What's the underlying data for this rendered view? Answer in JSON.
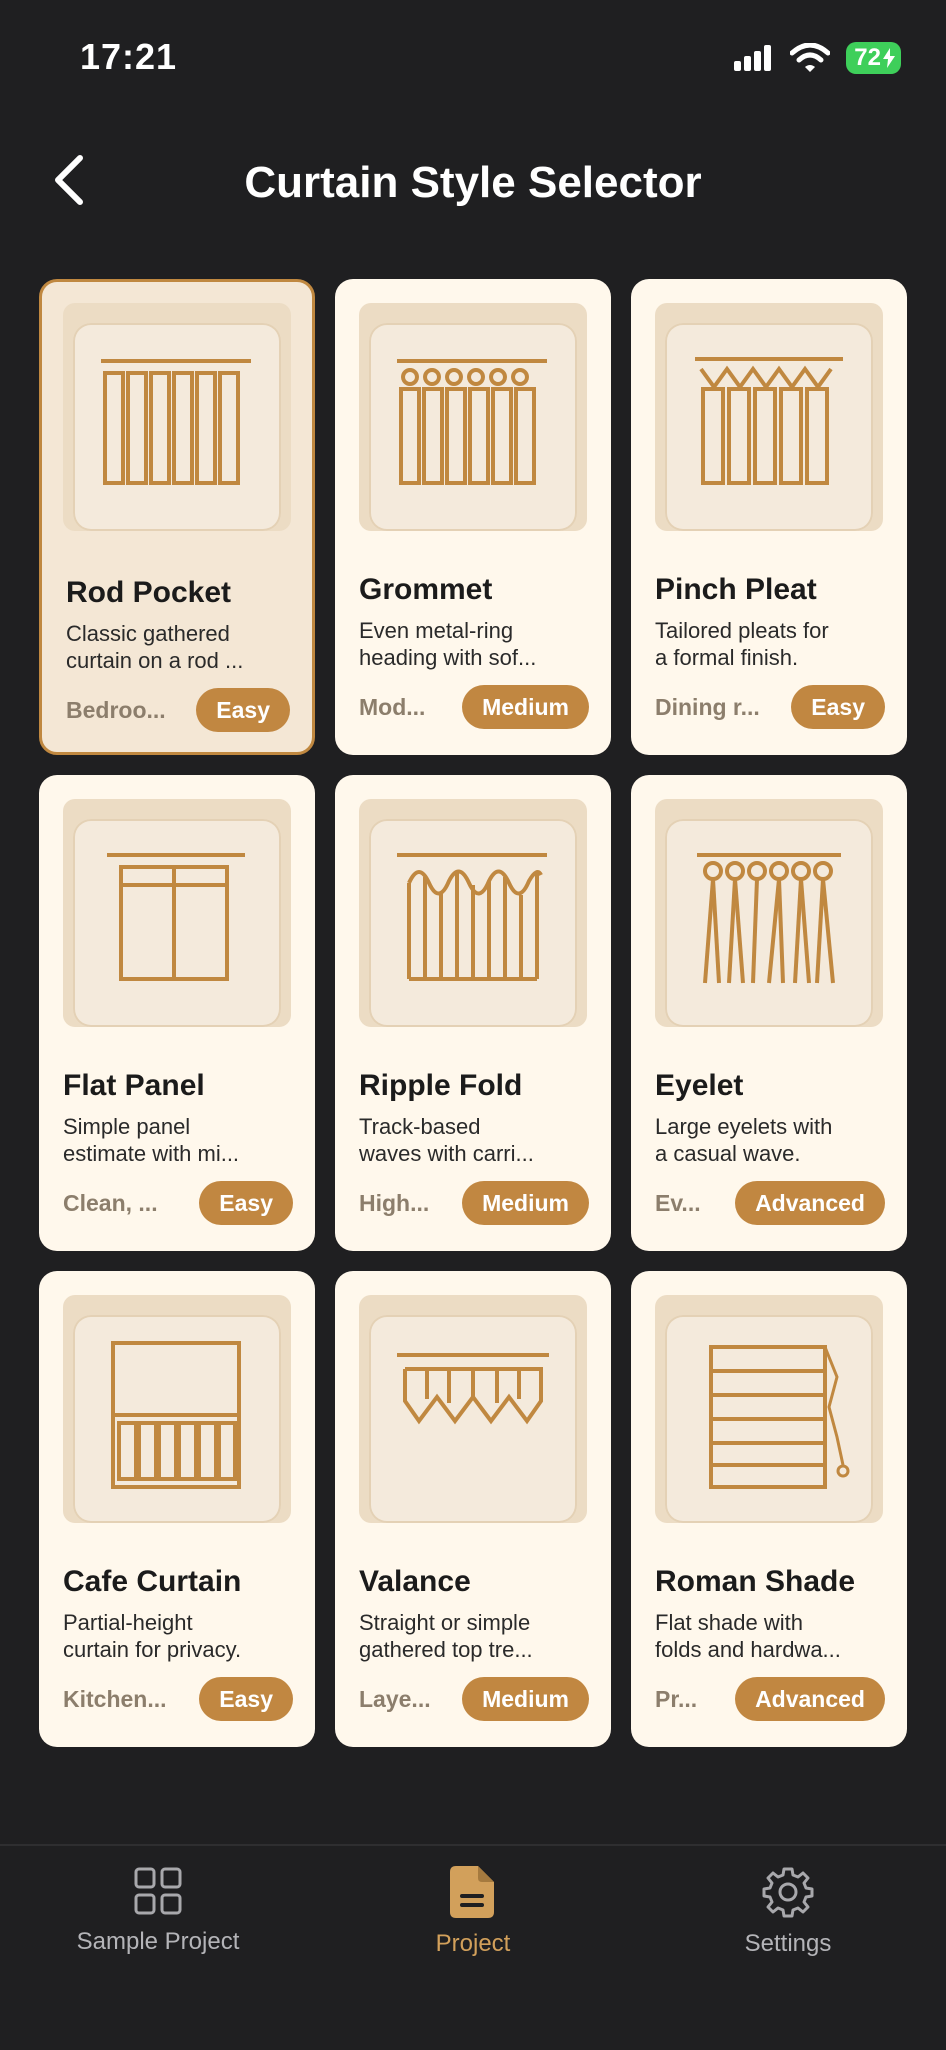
{
  "status": {
    "time": "17:21",
    "battery": "72"
  },
  "header": {
    "title": "Curtain Style Selector"
  },
  "cards": [
    {
      "title": "Rod Pocket",
      "desc1": "Classic gathered",
      "desc2": "curtain on a rod ...",
      "tag": "Bedroo...",
      "difficulty": "Easy",
      "selected": true
    },
    {
      "title": "Grommet",
      "desc1": "Even metal-ring",
      "desc2": "heading with sof...",
      "tag": "Mod...",
      "difficulty": "Medium"
    },
    {
      "title": "Pinch Pleat",
      "desc1": "Tailored pleats for",
      "desc2": "a formal finish.",
      "tag": "Dining r...",
      "difficulty": "Easy"
    },
    {
      "title": "Flat Panel",
      "desc1": "Simple panel",
      "desc2": "estimate with mi...",
      "tag": "Clean, ...",
      "difficulty": "Easy"
    },
    {
      "title": "Ripple Fold",
      "desc1": "Track-based",
      "desc2": "waves with carri...",
      "tag": "High...",
      "difficulty": "Medium"
    },
    {
      "title": "Eyelet",
      "desc1": "Large eyelets with",
      "desc2": "a casual wave.",
      "tag": "Ev...",
      "difficulty": "Advanced"
    },
    {
      "title": "Cafe Curtain",
      "desc1": "Partial-height",
      "desc2": "curtain for privacy.",
      "tag": "Kitchen...",
      "difficulty": "Easy"
    },
    {
      "title": "Valance",
      "desc1": "Straight or simple",
      "desc2": "gathered top tre...",
      "tag": "Laye...",
      "difficulty": "Medium"
    },
    {
      "title": "Roman Shade",
      "desc1": "Flat shade with",
      "desc2": "folds and hardwa...",
      "tag": "Pr...",
      "difficulty": "Advanced"
    }
  ],
  "tabs": [
    {
      "label": "Sample Project",
      "icon": "grid-icon"
    },
    {
      "label": "Project",
      "icon": "document-icon",
      "active": true
    },
    {
      "label": "Settings",
      "icon": "gear-icon"
    }
  ],
  "colors": {
    "accent": "#c18741",
    "card": "#fff8ec",
    "background": "#1f1f21"
  }
}
